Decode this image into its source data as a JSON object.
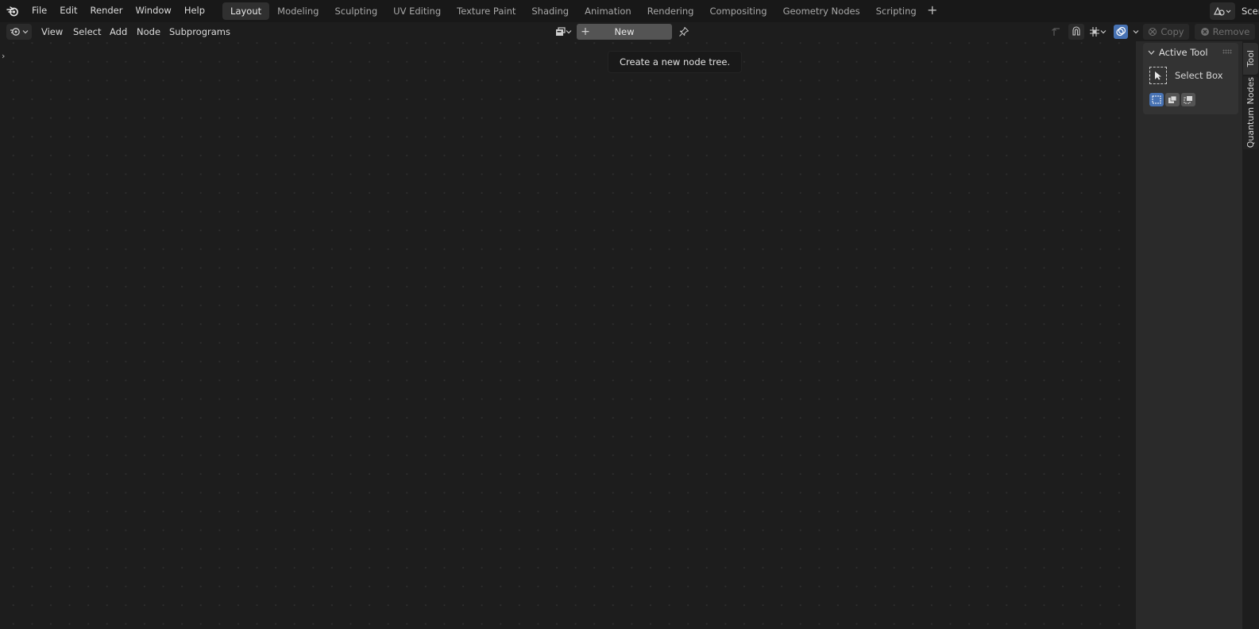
{
  "topbar": {
    "menus": [
      "File",
      "Edit",
      "Render",
      "Window",
      "Help"
    ],
    "workspaces": [
      "Layout",
      "Modeling",
      "Sculpting",
      "UV Editing",
      "Texture Paint",
      "Shading",
      "Animation",
      "Rendering",
      "Compositing",
      "Geometry Nodes",
      "Scripting"
    ],
    "active_workspace": "Layout",
    "scene_label": "Scen"
  },
  "header": {
    "menus": [
      "View",
      "Select",
      "Add",
      "Node",
      "Subprograms"
    ],
    "new_label": "New",
    "copy_label": "Copy",
    "remove_label": "Remove"
  },
  "tooltip": "Create a new node tree.",
  "sidebar": {
    "panel_title": "Active Tool",
    "tool_name": "Select Box",
    "tabs": [
      "Tool",
      "Quantum Nodes"
    ]
  },
  "colors": {
    "accent": "#4772b3",
    "canvas": "#1d1d1d",
    "topbar": "#181818",
    "sidebar": "#2a2a2a"
  }
}
